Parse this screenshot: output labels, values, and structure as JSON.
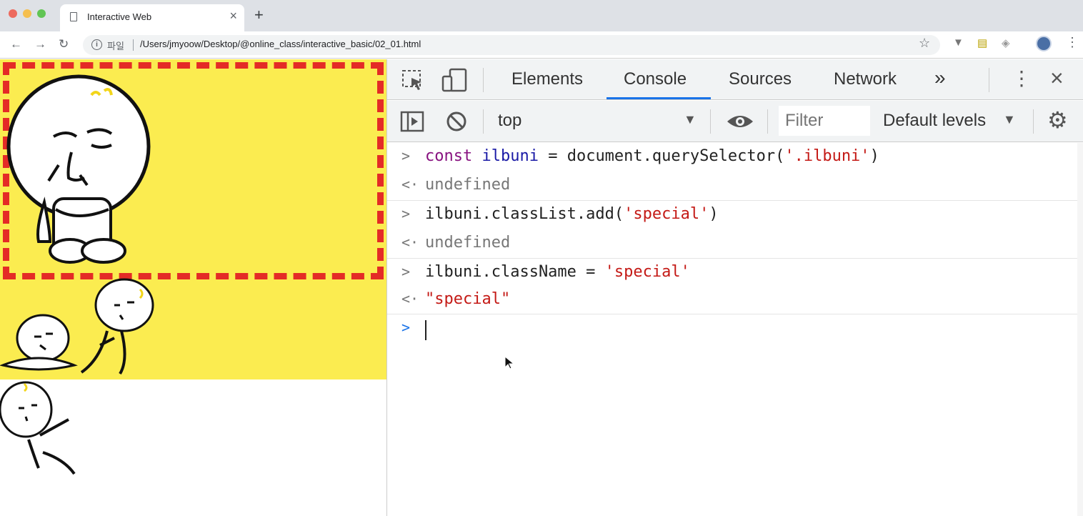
{
  "browser": {
    "tab_title": "Interactive Web",
    "new_tab": "+",
    "scheme_label": "파일",
    "url": "/Users/jmyoow/Desktop/@online_class/interactive_basic/02_01.html"
  },
  "devtools": {
    "tabs": [
      "Elements",
      "Console",
      "Sources",
      "Network"
    ],
    "more_tabs": "»",
    "context": "top",
    "filter_placeholder": "Filter",
    "levels": "Default levels"
  },
  "console": {
    "entries": [
      {
        "input": {
          "kw": "const",
          "var": "ilbuni",
          "rest": " = document.querySelector(",
          "str": "'.ilbuni'",
          "close": ")"
        },
        "output": "undefined"
      },
      {
        "input": {
          "pre": "ilbuni.classList.add(",
          "str": "'special'",
          "close": ")"
        },
        "output": "undefined"
      },
      {
        "input": {
          "pre": "ilbuni.className = ",
          "str": "'special'"
        },
        "output": "\"special\""
      }
    ]
  },
  "colors": {
    "yellow_bg": "#fbec50",
    "special_border": "#e42b26",
    "active_tab_underline": "#1a73e8"
  }
}
